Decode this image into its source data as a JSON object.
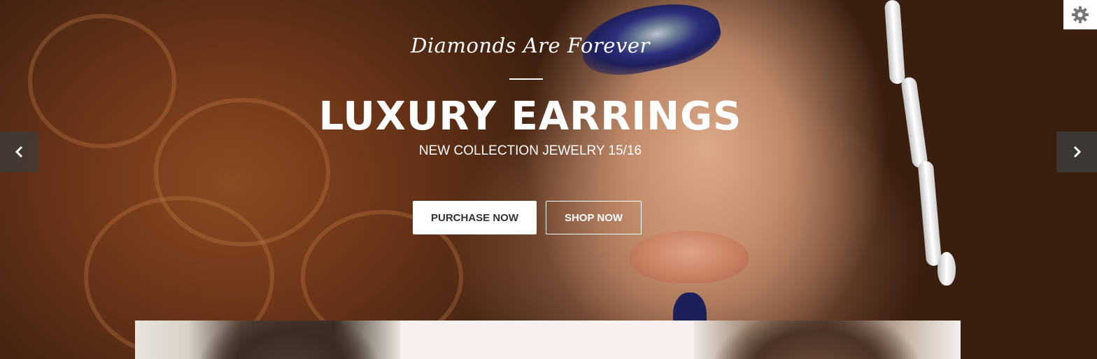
{
  "slider": {
    "tagline": "Diamonds Are Forever",
    "headline": "LUXURY EARRINGS",
    "subline": "NEW COLLECTION JEWELRY 15/16",
    "buttons": {
      "purchase_label": "PURCHASE NOW",
      "shop_label": "SHOP NOW"
    },
    "prev_icon": "chevron-left-icon",
    "next_icon": "chevron-right-icon"
  },
  "settings": {
    "icon": "gear-icon"
  },
  "colors": {
    "text_on_image": "#ffffff",
    "primary_button_bg": "#ffffff",
    "primary_button_text": "#333333",
    "arrow_bg": "#3c3c3c",
    "card_bg": "#f7f0ee"
  }
}
